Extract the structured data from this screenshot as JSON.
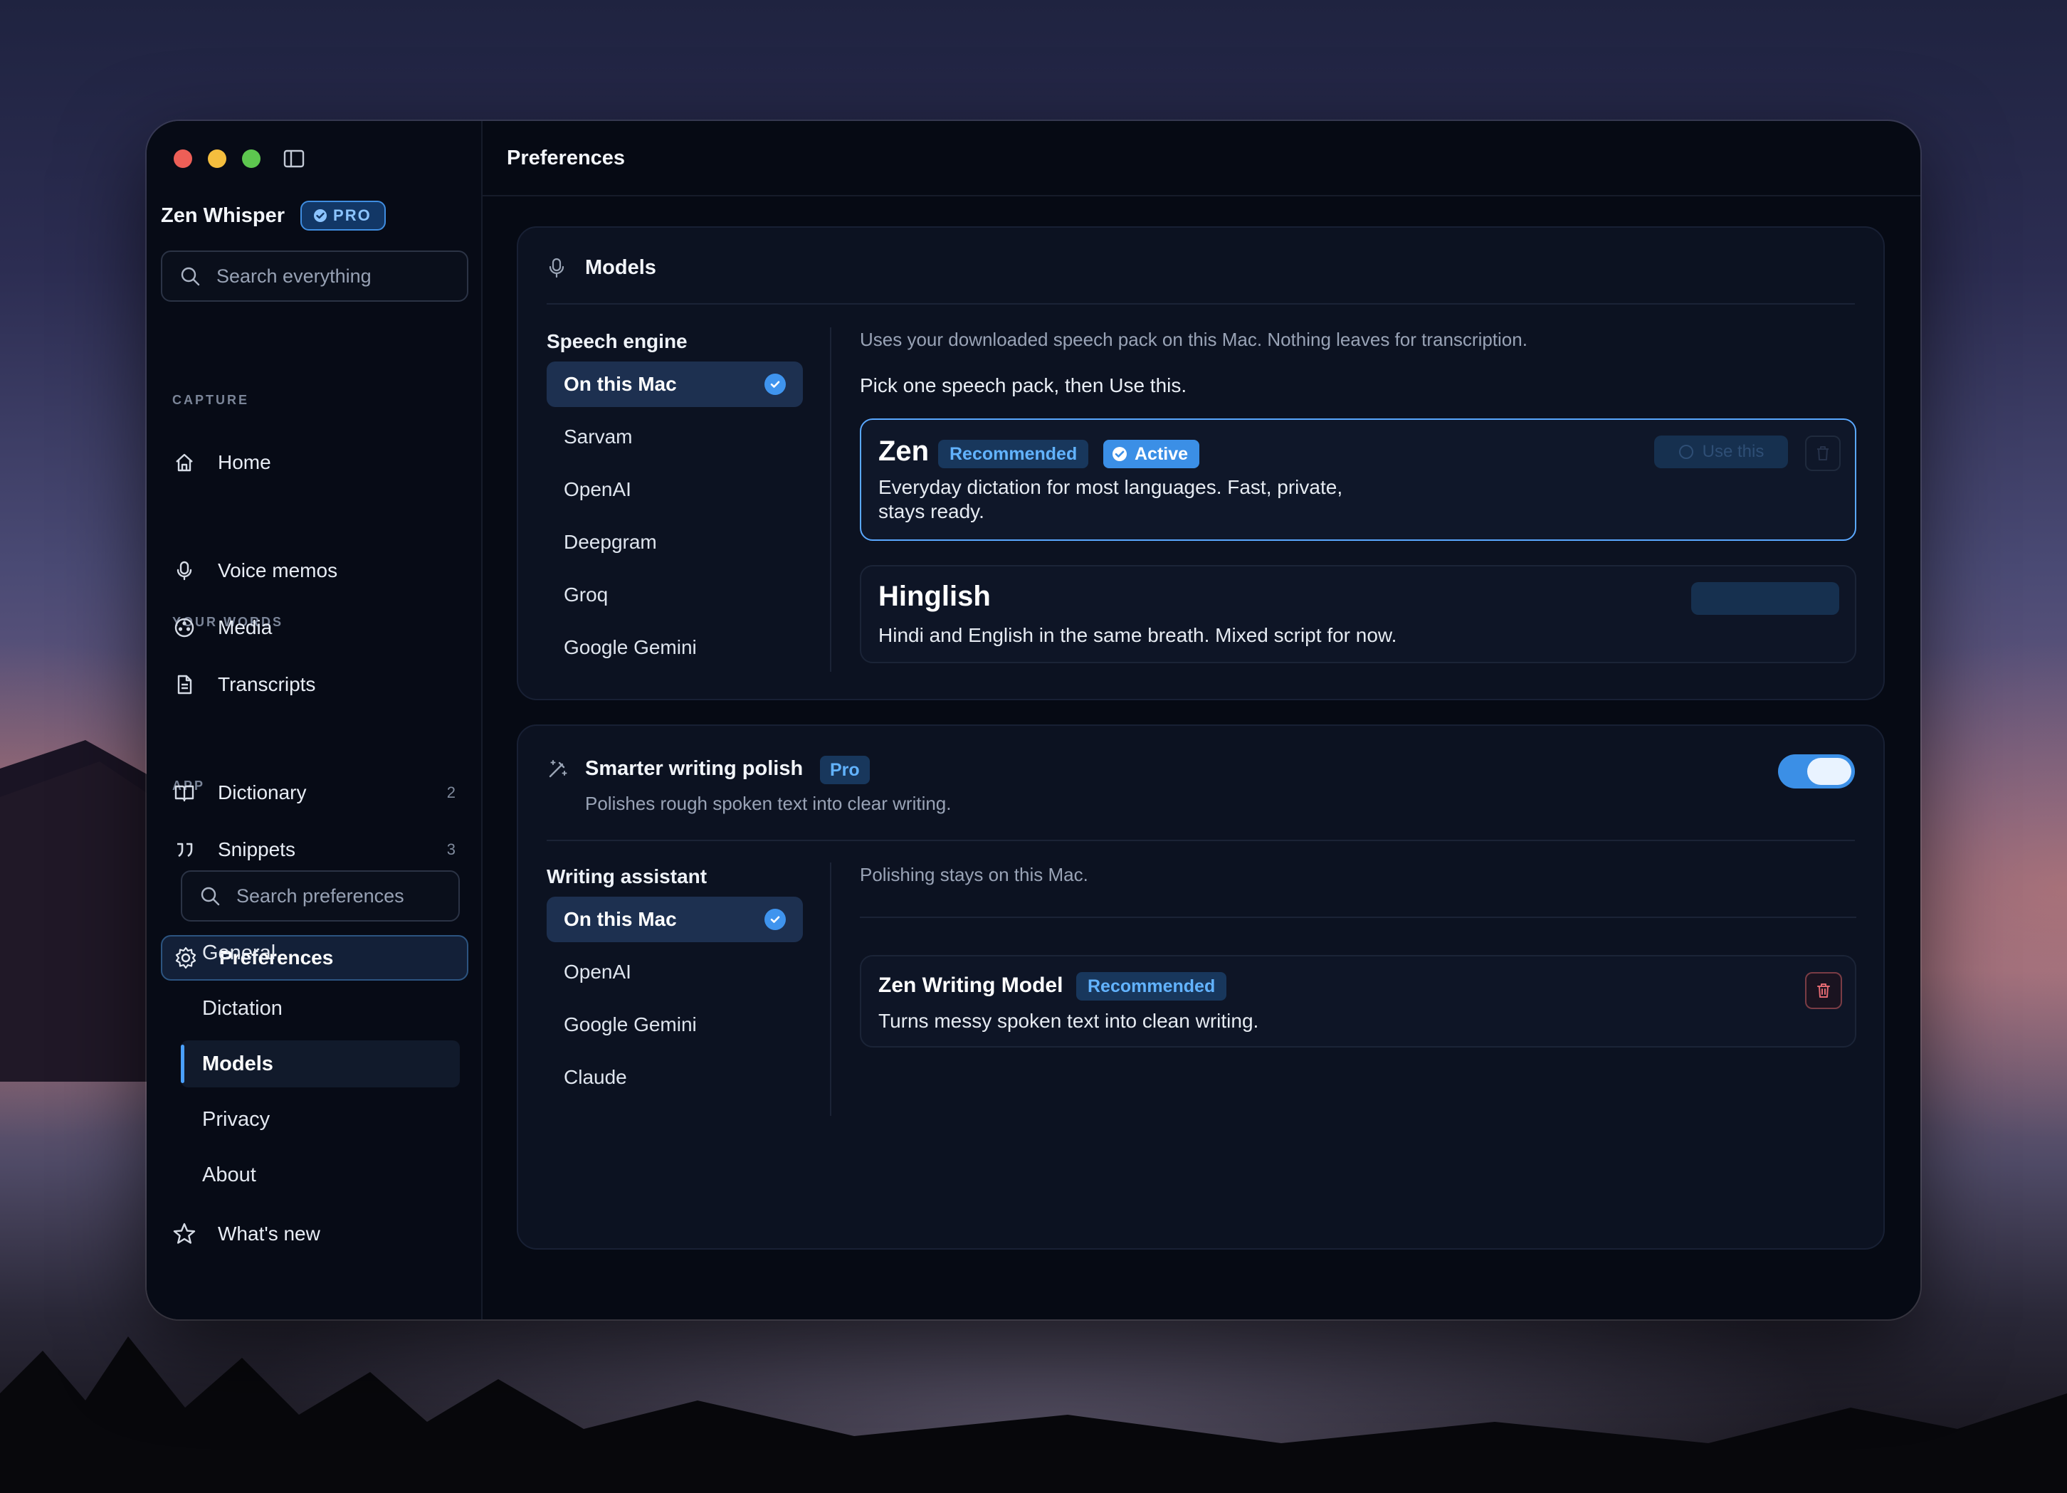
{
  "window": {
    "controls": [
      "close",
      "minimize",
      "zoom"
    ],
    "app_name": "Zen Whisper",
    "pro_badge": "PRO"
  },
  "sidebar": {
    "search_placeholder": "Search everything",
    "home": "Home",
    "sections": {
      "capture": "CAPTURE",
      "your_words": "YOUR WORDS",
      "app": "APP"
    },
    "capture_items": [
      {
        "label": "Voice memos",
        "icon": "microphone-icon"
      },
      {
        "label": "Media",
        "icon": "film-reel-icon"
      },
      {
        "label": "Transcripts",
        "icon": "document-icon"
      }
    ],
    "words_items": [
      {
        "label": "Dictionary",
        "count": "2",
        "icon": "book-icon"
      },
      {
        "label": "Snippets",
        "count": "3",
        "icon": "quote-icon"
      }
    ],
    "preferences": "Preferences",
    "pref_search_placeholder": "Search preferences",
    "pref_items": [
      "General",
      "Dictation",
      "Models",
      "Privacy",
      "About"
    ],
    "active_pref": "Models",
    "whats_new": "What's new"
  },
  "header": {
    "title": "Preferences"
  },
  "models": {
    "title": "Models",
    "speech_engine_label": "Speech engine",
    "engines": [
      "On this Mac",
      "Sarvam",
      "OpenAI",
      "Deepgram",
      "Groq",
      "Google Gemini"
    ],
    "selected_engine": "On this Mac",
    "description": "Uses your downloaded speech pack on this Mac. Nothing leaves for transcription.",
    "instruction": "Pick one speech pack, then Use this.",
    "packs": [
      {
        "name": "Zen",
        "tags": [
          "Recommended",
          "Active"
        ],
        "desc_line1": "Everyday dictation for most languages. Fast, private,",
        "desc_line2": "stays ready.",
        "button": "Use this"
      },
      {
        "name": "Hinglish",
        "tags": [],
        "desc_line1": "Hindi and English in the same breath. Mixed script for now.",
        "desc_line2": ""
      }
    ]
  },
  "polish": {
    "title": "Smarter writing polish",
    "pro_tag": "Pro",
    "subtitle": "Polishes rough spoken text into clear writing.",
    "enabled": true,
    "assistant_label": "Writing assistant",
    "assistants": [
      "On this Mac",
      "OpenAI",
      "Google Gemini",
      "Claude"
    ],
    "selected_assistant": "On this Mac",
    "note": "Polishing stays on this Mac.",
    "model": {
      "name": "Zen Writing Model",
      "tag": "Recommended",
      "desc": "Turns messy spoken text into clean writing."
    }
  },
  "colors": {
    "accent": "#3b8fe6",
    "accent_light": "#62b3ff",
    "window_bg": "#060a14",
    "card_bg": "#0c1221"
  }
}
